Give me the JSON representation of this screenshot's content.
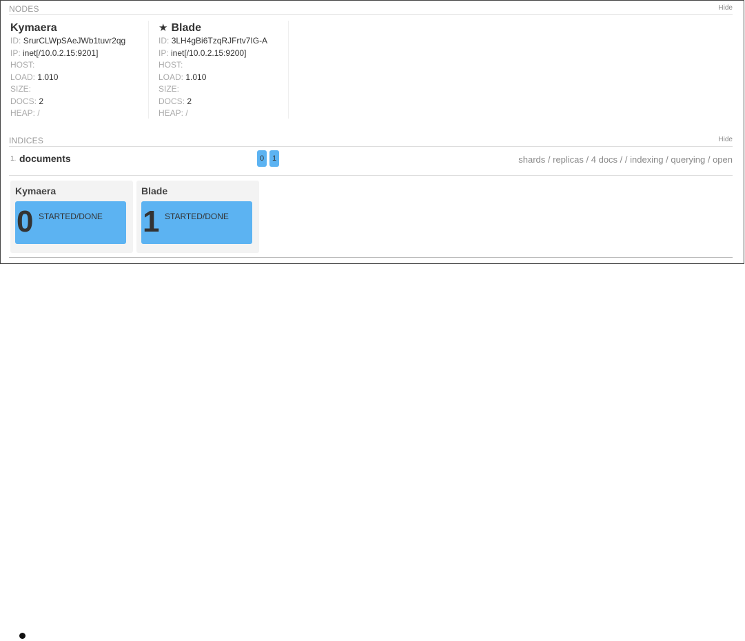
{
  "nodes_section": {
    "title": "NODES",
    "hide_label": "Hide",
    "nodes": [
      {
        "name": "Kymaera",
        "master": false,
        "id_label": "ID:",
        "id": "SrurCLWpSAeJWb1tuvr2qg",
        "ip_label": "IP:",
        "ip": "inet[/10.0.2.15:9201]",
        "host_label": "HOST:",
        "host": "",
        "load_label": "LOAD:",
        "load": "1.010",
        "size_label": "SIZE:",
        "size": "",
        "docs_label": "DOCS:",
        "docs": "2",
        "heap_label": "HEAP:",
        "heap": "/"
      },
      {
        "name": "Blade",
        "master": true,
        "star": "★",
        "id_label": "ID:",
        "id": "3LH4gBi6TzqRJFrtv7IG-A",
        "ip_label": "IP:",
        "ip": "inet[/10.0.2.15:9200]",
        "host_label": "HOST:",
        "host": "",
        "load_label": "LOAD:",
        "load": "1.010",
        "size_label": "SIZE:",
        "size": "",
        "docs_label": "DOCS:",
        "docs": "2",
        "heap_label": "HEAP:",
        "heap": "/"
      }
    ]
  },
  "indices_section": {
    "title": "INDICES",
    "hide_label": "Hide",
    "index": {
      "number": "1.",
      "name": "documents",
      "shard_chips": [
        "0",
        "1"
      ],
      "status": "shards / replicas / 4 docs / / indexing / querying / open"
    },
    "shard_nodes": [
      {
        "name": "Kymaera",
        "shard": "0",
        "state": "STARTED/DONE"
      },
      {
        "name": "Blade",
        "shard": "1",
        "state": "STARTED/DONE"
      }
    ]
  },
  "colors": {
    "shard_blue": "#5cb3f2",
    "label_gray": "#aaaaaa",
    "text_dark": "#333333"
  }
}
